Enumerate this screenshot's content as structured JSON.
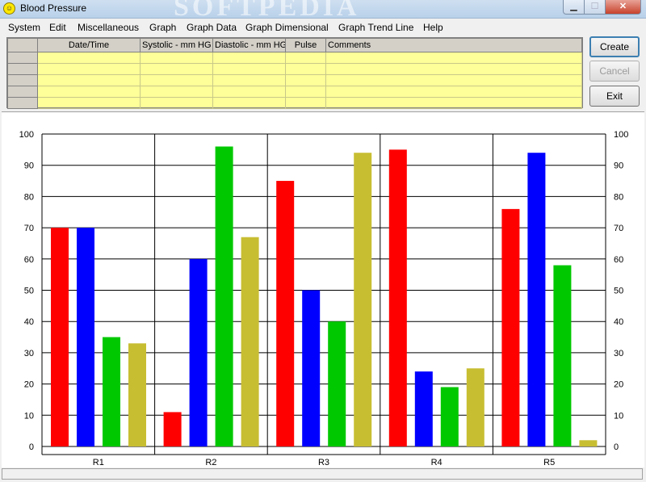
{
  "window": {
    "title": "Blood Pressure",
    "watermark": "SOFTPEDIA"
  },
  "menu": [
    "System",
    "Edit",
    "Miscellaneous",
    "Graph",
    "Graph Data",
    "Graph Dimensional",
    "Graph Trend Line",
    "Help"
  ],
  "grid": {
    "columns": [
      "Date/Time",
      "Systolic - mm HG",
      "Diastolic - mm HG",
      "Pulse",
      "Comments"
    ],
    "row_count": 5
  },
  "buttons": {
    "create": "Create",
    "cancel": "Cancel",
    "exit": "Exit"
  },
  "colors": {
    "red": "#ff0000",
    "blue": "#0000ff",
    "green": "#00c800",
    "olive": "#c8be32",
    "grid_bg": "#ffff99"
  },
  "chart_data": {
    "type": "bar",
    "categories": [
      "R1",
      "R2",
      "R3",
      "R4",
      "R5"
    ],
    "series": [
      {
        "values": [
          70,
          11,
          85,
          95,
          76
        ],
        "color": "#ff0000"
      },
      {
        "values": [
          70,
          60,
          50,
          24,
          94
        ],
        "color": "#0000ff"
      },
      {
        "values": [
          35,
          96,
          40,
          19,
          58
        ],
        "color": "#00c800"
      },
      {
        "values": [
          33,
          67,
          94,
          25,
          2
        ],
        "color": "#c8be32"
      }
    ],
    "ylim": [
      0,
      100
    ],
    "yticks": [
      0,
      10,
      20,
      30,
      40,
      50,
      60,
      70,
      80,
      90,
      100
    ],
    "grid": true,
    "right_axis": true
  }
}
